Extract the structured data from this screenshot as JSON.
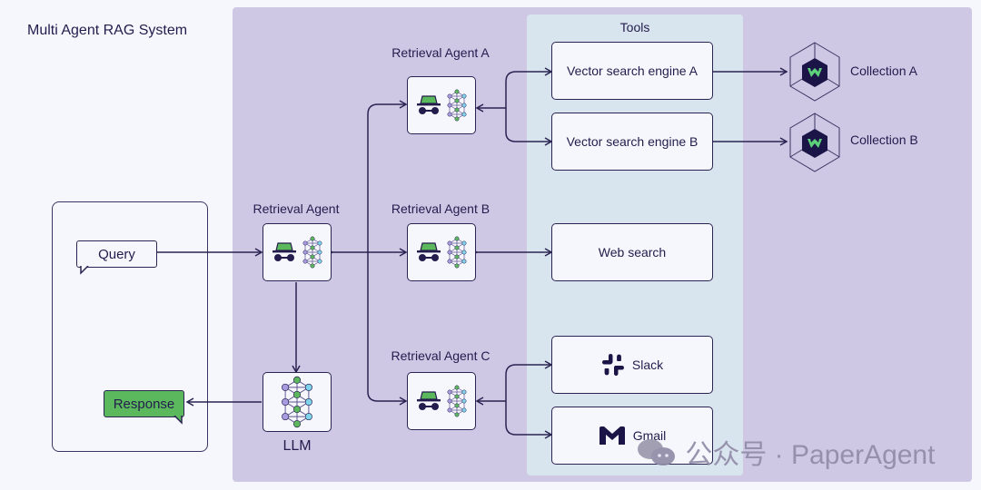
{
  "title": "Multi Agent RAG System",
  "tools_title": "Tools",
  "client": {
    "query": "Query",
    "response": "Response"
  },
  "agents": {
    "main": {
      "label": "Retrieval Agent",
      "icon": "agent-icon"
    },
    "a": {
      "label": "Retrieval Agent A",
      "icon": "agent-icon"
    },
    "b": {
      "label": "Retrieval Agent B",
      "icon": "agent-icon"
    },
    "c": {
      "label": "Retrieval Agent C",
      "icon": "agent-icon"
    }
  },
  "llm": {
    "label": "LLM",
    "icon": "neural-network-icon"
  },
  "tools": [
    {
      "label": "Vector search engine A",
      "icon": null
    },
    {
      "label": "Vector search engine B",
      "icon": null
    },
    {
      "label": "Web search",
      "icon": null
    },
    {
      "label": "Slack",
      "icon": "slack-icon"
    },
    {
      "label": "Gmail",
      "icon": "gmail-icon"
    }
  ],
  "collections": [
    {
      "label": "Collection A",
      "icon": "weaviate-cube-icon"
    },
    {
      "label": "Collection B",
      "icon": "weaviate-cube-icon"
    }
  ],
  "colors": {
    "panel": "#cfc8e5",
    "tools_panel": "#d9e5ee",
    "ink": "#231c4d",
    "accent_green": "#5cb85c",
    "node_purple": "#a99be0",
    "node_cyan": "#7fd4ec"
  },
  "watermark": "公众号 · PaperAgent"
}
